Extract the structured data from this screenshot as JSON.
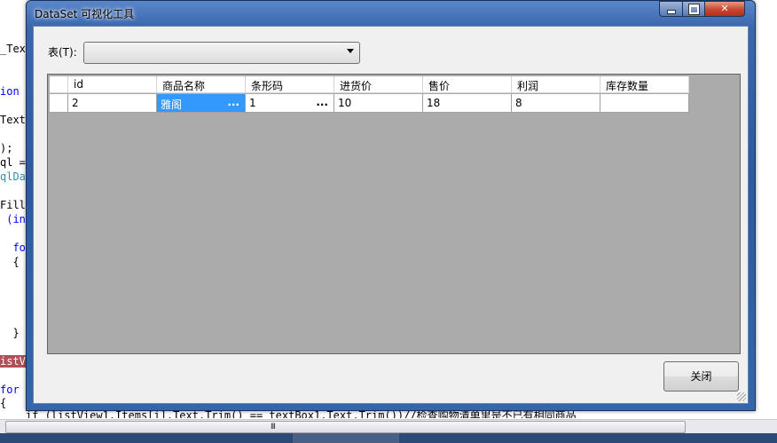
{
  "editor": {
    "lines": [
      {
        "text": "_Tex",
        "cls": ""
      },
      {
        "text": "ion c",
        "cls": "kw"
      },
      {
        "text": "Text",
        "cls": ""
      },
      {
        "text": ");",
        "cls": ""
      },
      {
        "text": "ql =",
        "cls": ""
      },
      {
        "text": "qlDat",
        "cls": "tp"
      },
      {
        "text": "Fill(",
        "cls": ""
      },
      {
        "text": " (in",
        "cls": "kw"
      },
      {
        "text": "  for",
        "cls": "kw"
      },
      {
        "text": "  {",
        "cls": ""
      },
      {
        "text": "  }",
        "cls": ""
      },
      {
        "text": "istV",
        "cls": "hl"
      },
      {
        "text": "for (",
        "cls": "kw"
      },
      {
        "text": "{",
        "cls": ""
      },
      {
        "text": "    if (listView1.Items[i].Text.Trim() == textBox1.Text.Trim())//检查购物清单里是不已有相同商品",
        "cls": "cm"
      }
    ],
    "scroll_grip": "III"
  },
  "window": {
    "title": "DataSet 可视化工具",
    "minimize_glyph": "minimize-icon",
    "maximize_glyph": "maximize-icon",
    "close_glyph": "✕"
  },
  "form": {
    "table_label": "表(T):",
    "table_value": "",
    "close_label": "关闭"
  },
  "grid": {
    "columns": [
      "id",
      "商品名称",
      "条形码",
      "进货价",
      "售价",
      "利润",
      "库存数量"
    ],
    "rows": [
      [
        "2",
        "雅阁",
        "1",
        "10",
        "18",
        "8",
        ""
      ]
    ],
    "ellipsis": "..."
  }
}
